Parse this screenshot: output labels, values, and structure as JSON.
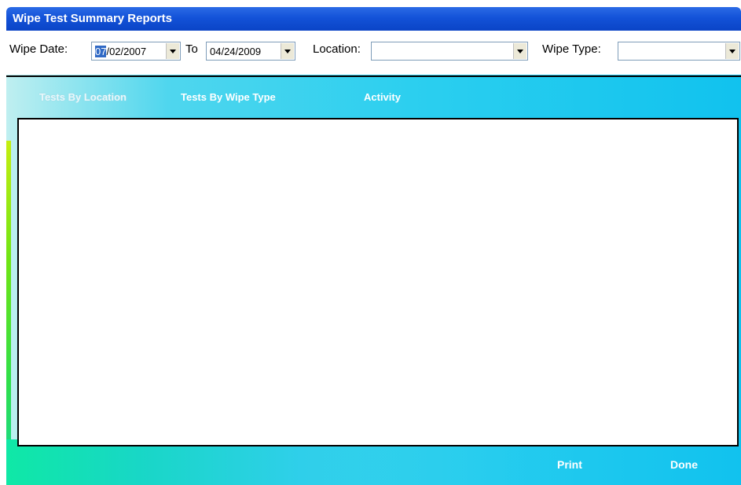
{
  "window": {
    "title": "Wipe Test Summary Reports"
  },
  "filters": {
    "wipe_date_label": "Wipe Date:",
    "from_date_selected": "07",
    "from_date_rest": "/02/2007",
    "to_label": "To",
    "to_date": "04/24/2009",
    "location_label": "Location:",
    "location_value": "",
    "wipe_type_label": "Wipe Type:",
    "wipe_type_value": ""
  },
  "tabs": [
    {
      "label": "Tests By Location",
      "active": true
    },
    {
      "label": "Tests By Wipe Type",
      "active": false
    },
    {
      "label": "Activity",
      "active": false
    }
  ],
  "actions": {
    "print_label": "Print",
    "done_label": "Done"
  },
  "colors": {
    "title_bar": "#0a44c6",
    "background_cyan": "#11c2ee",
    "accent_green": "#2fdf4a"
  }
}
